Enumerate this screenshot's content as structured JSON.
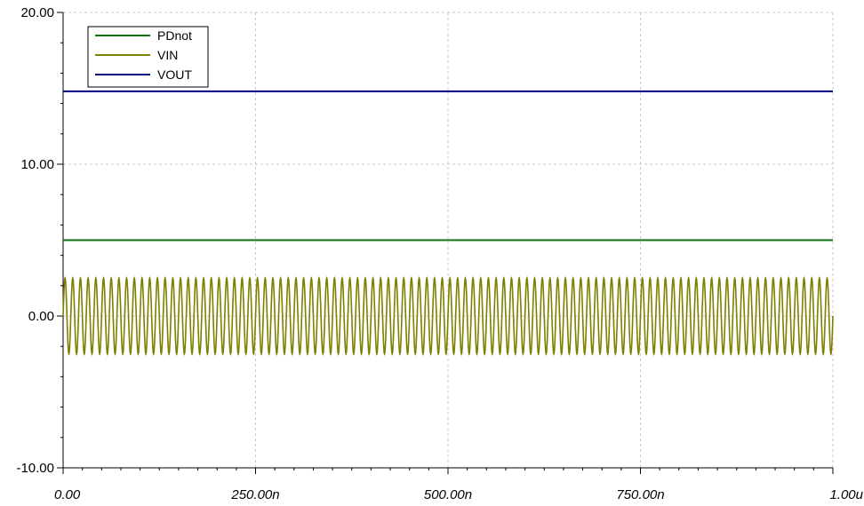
{
  "chart_data": {
    "type": "line",
    "title": "",
    "xlabel": "",
    "ylabel": "",
    "xlim": [
      0,
      1.0
    ],
    "ylim": [
      -10,
      20
    ],
    "x_ticks": [
      {
        "value": 0,
        "label": "0.00"
      },
      {
        "value": 0.25,
        "label": "250.00n"
      },
      {
        "value": 0.5,
        "label": "500.00n"
      },
      {
        "value": 0.75,
        "label": "750.00n"
      },
      {
        "value": 1.0,
        "label": "1.00u"
      }
    ],
    "y_ticks": [
      {
        "value": -10,
        "label": "-10.00"
      },
      {
        "value": 0,
        "label": "0.00"
      },
      {
        "value": 10,
        "label": "10.00"
      },
      {
        "value": 20,
        "label": "20.00"
      }
    ],
    "grid": true,
    "legend_position": "top-left",
    "series": [
      {
        "name": "PDnot",
        "color": "#107010",
        "kind": "constant",
        "x": [
          0,
          1.0
        ],
        "y": [
          5.0,
          5.0
        ]
      },
      {
        "name": "VIN",
        "color": "#7f7f00",
        "kind": "sine",
        "amplitude": 2.5,
        "offset": 0.0,
        "cycles": 100,
        "x_range": [
          0,
          1.0
        ]
      },
      {
        "name": "VOUT",
        "color": "#00007f",
        "kind": "constant",
        "x": [
          0,
          1.0
        ],
        "y": [
          14.8,
          14.8
        ]
      }
    ]
  }
}
